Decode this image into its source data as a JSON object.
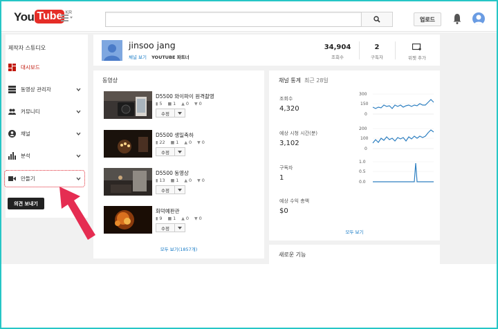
{
  "header": {
    "logo_you": "You",
    "logo_tube": "Tube",
    "logo_region": "KR",
    "search_placeholder": "",
    "upload_label": "업로드"
  },
  "sidebar": {
    "title": "제작자 스튜디오",
    "items": [
      {
        "label": "대시보드",
        "icon": "dashboard-icon",
        "active": true
      },
      {
        "label": "동영상 관리자",
        "icon": "video-manager-icon"
      },
      {
        "label": "커뮤니티",
        "icon": "community-icon"
      },
      {
        "label": "채널",
        "icon": "channel-icon"
      },
      {
        "label": "분석",
        "icon": "analytics-icon"
      },
      {
        "label": "만들기",
        "icon": "create-video-icon"
      }
    ],
    "feedback_label": "의견 보내기"
  },
  "profile": {
    "name": "jinsoo jang",
    "view_channel": "채널 보기",
    "partner": "YOUTUBE 파트너",
    "views_value": "34,904",
    "views_label": "조회수",
    "subs_value": "2",
    "subs_label": "구독자",
    "add_widget_label": "위젯 추가"
  },
  "videos": {
    "title": "동영상",
    "edit_label": "수정",
    "see_all": "모두 보기(1857개)",
    "items": [
      {
        "title": "D5500 와이파이 원격촬영",
        "views": "5",
        "comments": "1",
        "likes": "0",
        "dislikes": "0"
      },
      {
        "title": "D5500 생일축하",
        "views": "22",
        "comments": "1",
        "likes": "0",
        "dislikes": "0"
      },
      {
        "title": "D5500 동영상",
        "views": "13",
        "comments": "1",
        "likes": "0",
        "dislikes": "0"
      },
      {
        "title": "화덕예판관",
        "views": "9",
        "comments": "1",
        "likes": "0",
        "dislikes": "0"
      }
    ]
  },
  "stats": {
    "title": "채널 통계",
    "subtitle": "최근 28일",
    "see_all": "모두 보기",
    "metrics": [
      {
        "label": "조회수",
        "value": "4,320",
        "ticks": [
          "300",
          "150",
          "0"
        ]
      },
      {
        "label": "예상 시청 시간(분)",
        "value": "3,102",
        "ticks": [
          "200",
          "100",
          "0"
        ]
      },
      {
        "label": "구독자",
        "value": "1",
        "ticks": [
          "1.0",
          "0.5",
          "0.0"
        ]
      },
      {
        "label": "예상 수익 총액",
        "value": "$0"
      }
    ]
  },
  "new_features": {
    "title": "새로운 기능"
  },
  "colors": {
    "accent_red": "#e52d27",
    "link_blue": "#167ac6",
    "spark_line": "#2d7fc1",
    "highlight": "#e0232e"
  }
}
